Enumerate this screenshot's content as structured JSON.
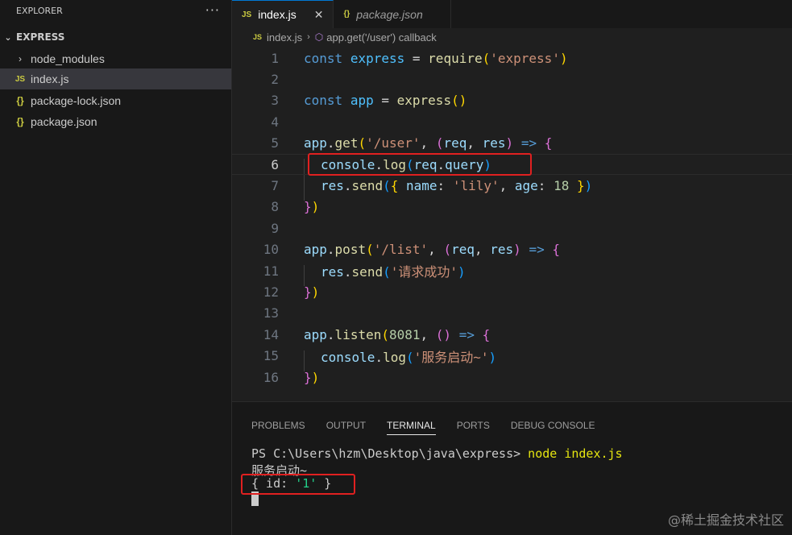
{
  "sidebar": {
    "title": "EXPLORER",
    "more": "···",
    "folder": "EXPRESS",
    "items": [
      {
        "label": "node_modules",
        "icon": "chevron-right-icon",
        "glyph": "›"
      },
      {
        "label": "index.js",
        "icon": "js-file-icon",
        "glyph": "JS",
        "selected": true
      },
      {
        "label": "package-lock.json",
        "icon": "json-file-icon",
        "glyph": "{}"
      },
      {
        "label": "package.json",
        "icon": "json-file-icon",
        "glyph": "{}"
      }
    ]
  },
  "tabs": [
    {
      "label": "index.js",
      "icon": "JS",
      "active": true,
      "close": "✕"
    },
    {
      "label": "package.json",
      "icon": "{}",
      "active": false
    }
  ],
  "breadcrumb": {
    "file": "index.js",
    "file_icon": "JS",
    "separator": "›",
    "symbol_icon": "⬡",
    "symbol": "app.get('/user') callback"
  },
  "code": {
    "line_numbers": [
      "1",
      "2",
      "3",
      "4",
      "5",
      "6",
      "7",
      "8",
      "9",
      "10",
      "11",
      "12",
      "13",
      "14",
      "15",
      "16"
    ],
    "current_line": "6"
  },
  "panel": {
    "tabs": [
      "PROBLEMS",
      "OUTPUT",
      "TERMINAL",
      "PORTS",
      "DEBUG CONSOLE"
    ],
    "active_tab": "TERMINAL",
    "prompt": "PS C:\\Users\\hzm\\Desktop\\java\\express> ",
    "command": "node index.js",
    "output1": "服务启动~",
    "output2_pre": "{ id: ",
    "output2_str": "'1'",
    "output2_post": " }"
  },
  "watermark": "@稀土掘金技术社区",
  "colors": {
    "accent": "#0078d4",
    "highlight_box": "#e02020"
  }
}
